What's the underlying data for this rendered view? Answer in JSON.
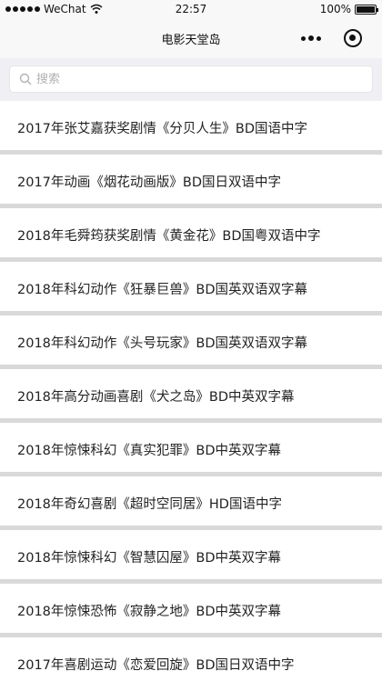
{
  "status_bar": {
    "carrier": "WeChat",
    "time": "22:57",
    "battery": "100%"
  },
  "nav": {
    "title": "电影天堂岛"
  },
  "search": {
    "placeholder": "搜索"
  },
  "list": {
    "items": [
      {
        "label": "2017年张艾嘉获奖剧情《分贝人生》BD国语中字"
      },
      {
        "label": "2017年动画《烟花动画版》BD国日双语中字"
      },
      {
        "label": "2018年毛舜筠获奖剧情《黄金花》BD国粤双语中字"
      },
      {
        "label": "2018年科幻动作《狂暴巨兽》BD国英双语双字幕"
      },
      {
        "label": "2018年科幻动作《头号玩家》BD国英双语双字幕"
      },
      {
        "label": "2018年高分动画喜剧《犬之岛》BD中英双字幕"
      },
      {
        "label": "2018年惊悚科幻《真实犯罪》BD中英双字幕"
      },
      {
        "label": "2018年奇幻喜剧《超时空同居》HD国语中字"
      },
      {
        "label": "2018年惊悚科幻《智慧囚屋》BD中英双字幕"
      },
      {
        "label": "2018年惊悚恐怖《寂静之地》BD中英双字幕"
      },
      {
        "label": "2017年喜剧运动《恋爱回旋》BD国日双语中字"
      }
    ]
  },
  "icons": {
    "signal": "signal-dots-icon",
    "wifi": "wifi-icon",
    "battery": "battery-icon",
    "more": "more-dots-icon",
    "close": "close-target-icon",
    "search": "search-icon"
  },
  "colors": {
    "nav_background": "#f8f8f8",
    "search_area_background": "#efeff4",
    "divider": "#d9d9d9",
    "text": "#222222"
  }
}
